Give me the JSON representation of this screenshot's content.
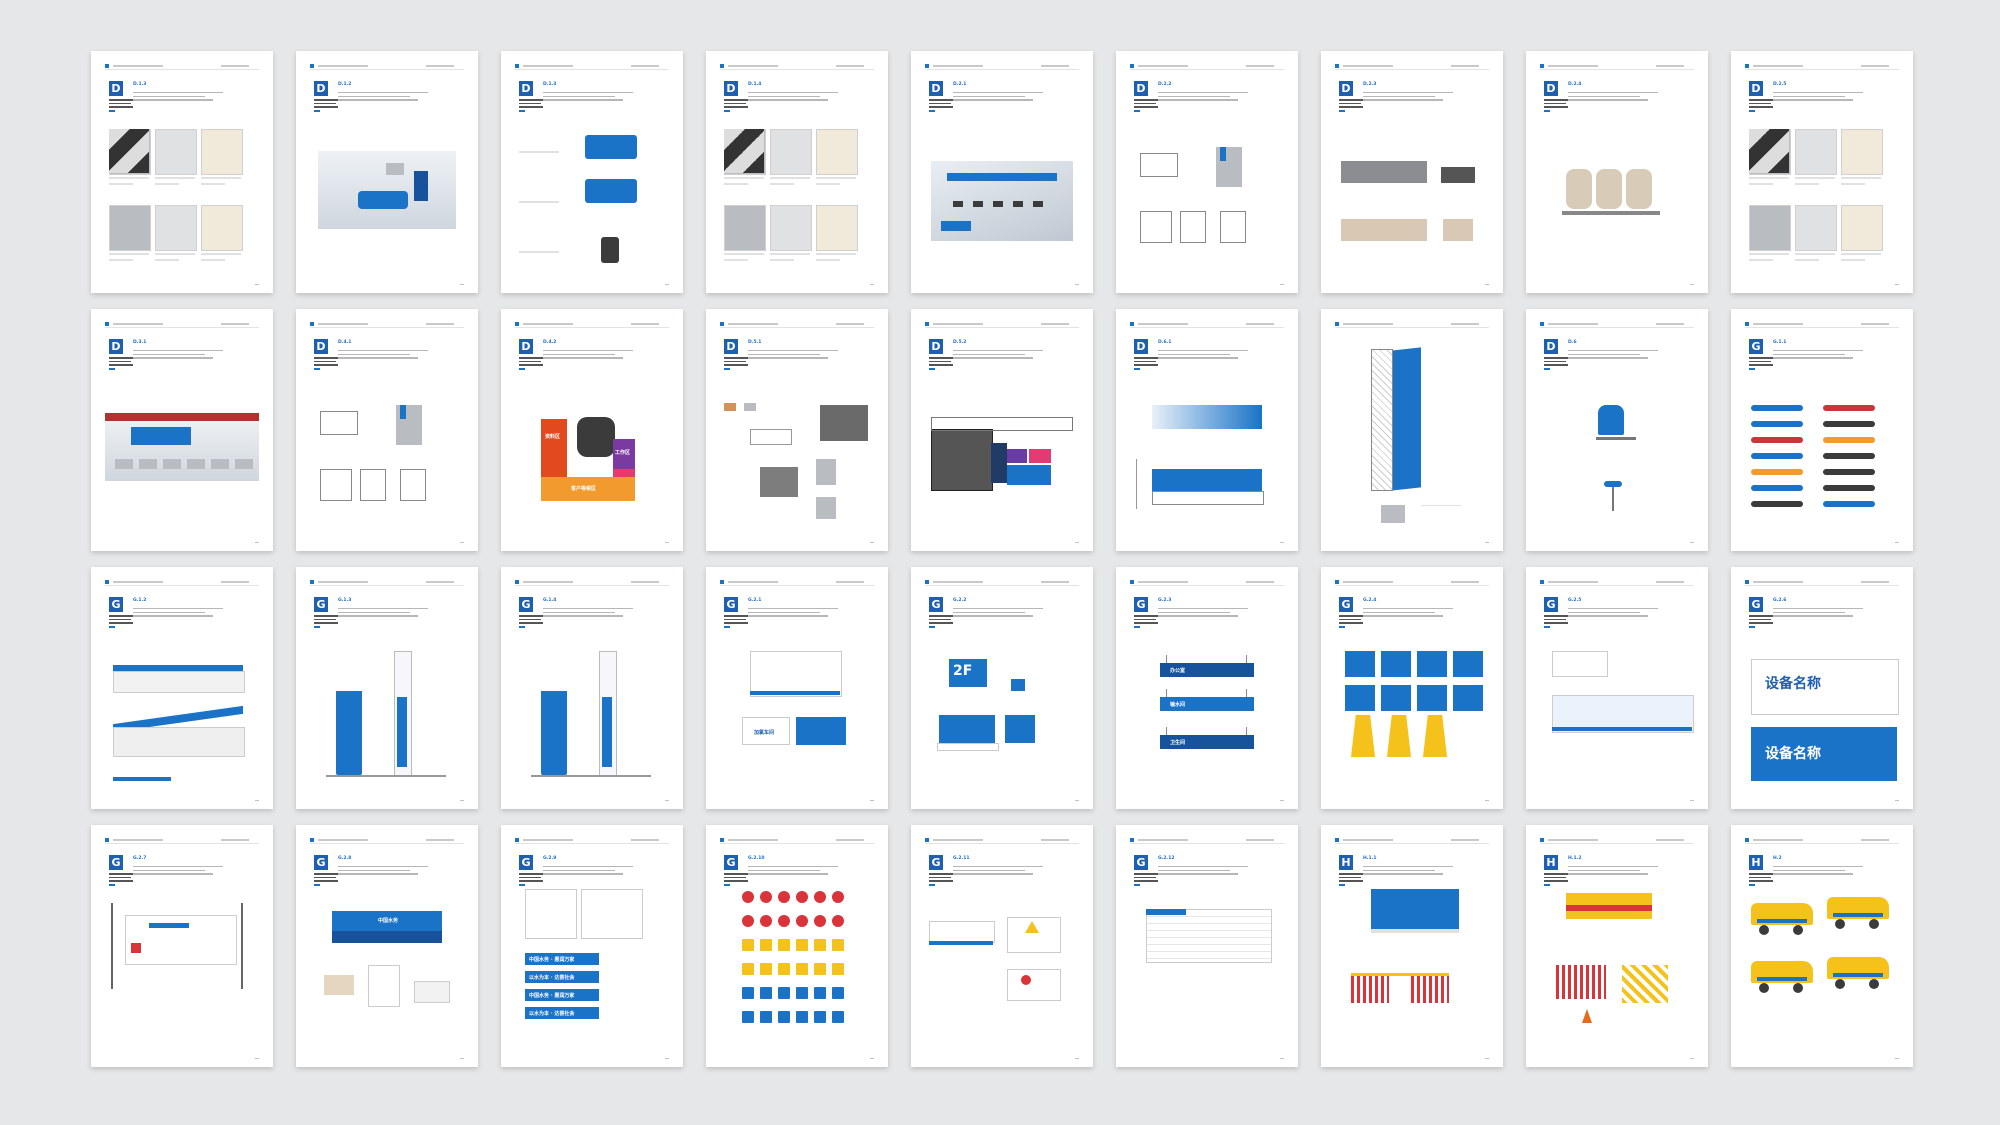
{
  "layout": {
    "cols": 9,
    "rows": 4
  },
  "pages": [
    {
      "badge": "D",
      "code": "D.1.3",
      "visual": "swatches"
    },
    {
      "badge": "D",
      "code": "D.1.2",
      "visual": "lobby"
    },
    {
      "badge": "D",
      "code": "D.1.3",
      "visual": "counter"
    },
    {
      "badge": "D",
      "code": "D.1.4",
      "visual": "swatches"
    },
    {
      "badge": "D",
      "code": "D.2.1",
      "visual": "room"
    },
    {
      "badge": "D",
      "code": "D.2.2",
      "visual": "drawing"
    },
    {
      "badge": "D",
      "code": "D.2.3",
      "visual": "sofa"
    },
    {
      "badge": "D",
      "code": "D.2.4",
      "visual": "seats"
    },
    {
      "badge": "D",
      "code": "D.2.5",
      "visual": "swatches"
    },
    {
      "badge": "D",
      "code": "D.3.1",
      "visual": "counters"
    },
    {
      "badge": "D",
      "code": "D.4.1",
      "visual": "drawing"
    },
    {
      "badge": "D",
      "code": "D.4.2",
      "visual": "zones"
    },
    {
      "badge": "D",
      "code": "D.5.1",
      "visual": "furniture"
    },
    {
      "badge": "D",
      "code": "D.5.2",
      "visual": "zones2"
    },
    {
      "badge": "D",
      "code": "D.6.1",
      "visual": "wall"
    },
    {
      "badge": "",
      "code": "",
      "visual": "tower"
    },
    {
      "badge": "D",
      "code": "D.6",
      "visual": "chair"
    },
    {
      "badge": "G",
      "code": "G.1.1",
      "visual": "pipes"
    },
    {
      "badge": "G",
      "code": "G.1.2",
      "visual": "building"
    },
    {
      "badge": "G",
      "code": "G.1.3",
      "visual": "pylon"
    },
    {
      "badge": "G",
      "code": "G.1.4",
      "visual": "pylon"
    },
    {
      "badge": "G",
      "code": "G.2.1",
      "visual": "panels"
    },
    {
      "badge": "G",
      "code": "G.2.2",
      "visual": "floor"
    },
    {
      "badge": "G",
      "code": "G.2.3",
      "visual": "hanging"
    },
    {
      "badge": "G",
      "code": "G.2.4",
      "visual": "icons"
    },
    {
      "badge": "G",
      "code": "G.2.5",
      "visual": "glass"
    },
    {
      "badge": "G",
      "code": "G.2.6",
      "visual": "device"
    },
    {
      "badge": "G",
      "code": "G.2.7",
      "visual": "board"
    },
    {
      "badge": "G",
      "code": "G.2.8",
      "visual": "gate"
    },
    {
      "badge": "G",
      "code": "G.2.9",
      "visual": "slogans"
    },
    {
      "badge": "G",
      "code": "G.2.10",
      "visual": "safety"
    },
    {
      "badge": "G",
      "code": "G.2.11",
      "visual": "notice"
    },
    {
      "badge": "G",
      "code": "G.2.12",
      "visual": "wallchart"
    },
    {
      "badge": "H",
      "code": "H.1.1",
      "visual": "fence"
    },
    {
      "badge": "H",
      "code": "H.1.2",
      "visual": "barrier"
    },
    {
      "badge": "H",
      "code": "H.2",
      "visual": "vehicles"
    }
  ],
  "texts": {
    "floor": "2F",
    "device_name": "设备名称",
    "slogan_1": "中国水务 · 惠润万家",
    "slogan_2": "以水为本 · 达善社会",
    "brand": "中国水务",
    "zone_a": "资料区",
    "zone_b": "工作区",
    "zone_c": "客户等候区",
    "zone_d": "办公室",
    "zone_e": "输水间",
    "zone_f": "卫生间",
    "service": "加氯车间"
  },
  "colors": {
    "accent": "#1a73c7",
    "dark_accent": "#16539c",
    "badge": "#1f5fb0",
    "warning": "#f5c21b",
    "danger": "#d8343a",
    "background": "#e6e7e9"
  }
}
